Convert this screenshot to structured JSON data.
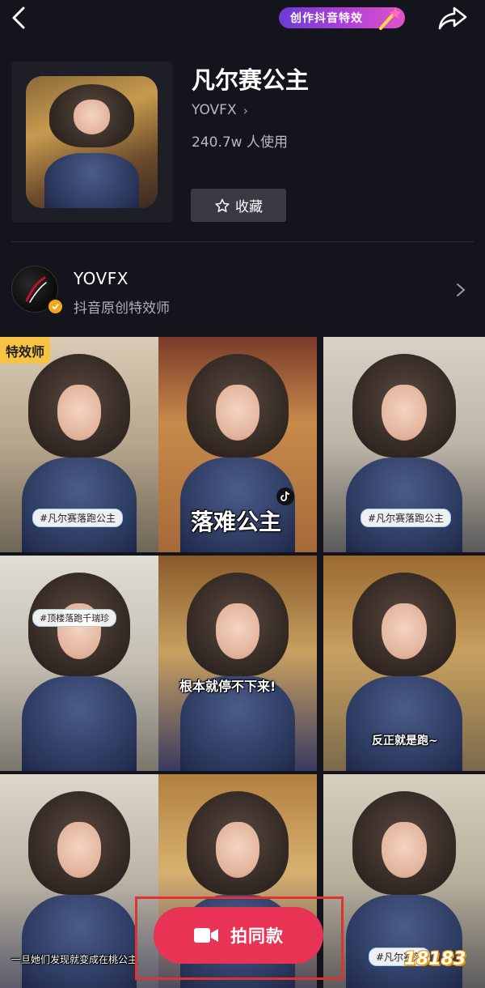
{
  "header": {
    "create_label": "创作抖音特效"
  },
  "effect": {
    "title": "凡尔赛公主",
    "creator": "YOVFX",
    "usage": "240.7w 人使用",
    "favorite_label": "收藏"
  },
  "author": {
    "name": "YOVFX",
    "subtitle": "抖音原创特效师"
  },
  "grid": {
    "badge": "特效师",
    "tiles": [
      {
        "chip": "#凡尔赛落跑公主",
        "caption": ""
      },
      {
        "chip": "",
        "caption": "落难公主"
      },
      {
        "chip": "#凡尔赛落跑公主",
        "caption": ""
      },
      {
        "chip": "#顶楼落跑千瑞珍",
        "caption": ""
      },
      {
        "chip": "",
        "caption": "根本就停不下来!"
      },
      {
        "chip": "",
        "caption": "反正就是跑~"
      },
      {
        "chip": "",
        "caption": "一旦她们发现就变成在桃公主"
      },
      {
        "chip": "",
        "caption": ""
      },
      {
        "chip": "#凡尔赛落",
        "caption": ""
      }
    ]
  },
  "action": {
    "shoot_label": "拍同款"
  },
  "watermark": "18183",
  "colors": {
    "background": "#14141c",
    "accent_red": "#e83355",
    "badge_yellow": "#f6c343",
    "verify_orange": "#f2a81a",
    "highlight_red": "#e0322e"
  }
}
